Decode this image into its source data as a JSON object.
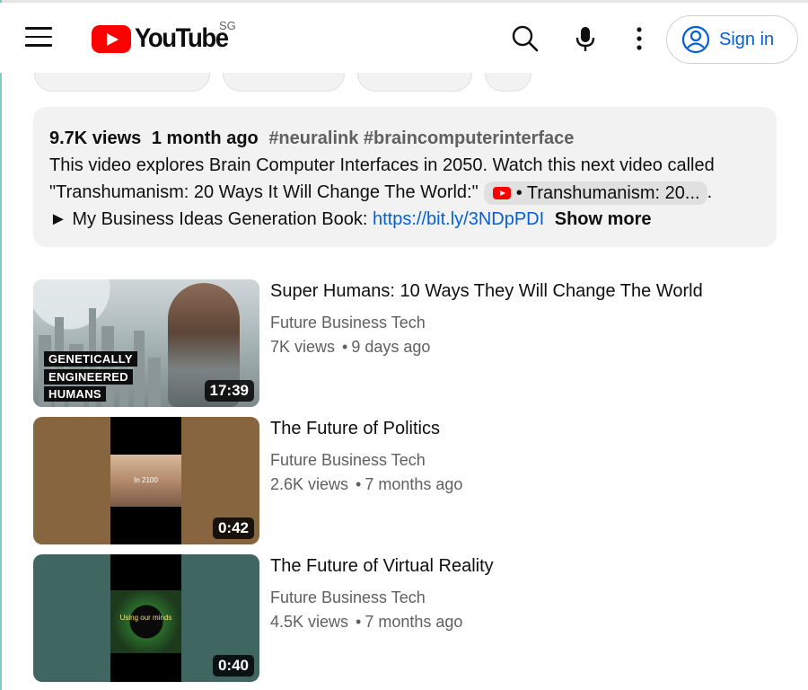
{
  "header": {
    "logo_text": "YouTube",
    "country": "SG",
    "signin_label": "Sign in",
    "icons": [
      "menu-icon",
      "search-icon",
      "microphone-icon",
      "more-vert-icon",
      "account-circle-icon"
    ]
  },
  "description": {
    "views": "9.7K views",
    "age": "1 month ago",
    "hashtags": "#neuralink #braincomputerinterface",
    "line1": "This video explores Brain Computer Interfaces in 2050. Watch this next video called",
    "line2_prefix": "\"Transhumanism: 20 Ways It Will Change The World:\"",
    "linked_video": "• Transhumanism: 20...",
    "line2_suffix": ".",
    "line3_prefix": "► My Business Ideas Generation Book:",
    "line3_link": "https://bit.ly/3NDpPDI",
    "show_more": "Show more"
  },
  "videos": [
    {
      "title": "Super Humans: 10 Ways They Will Change The World",
      "channel": "Future Business Tech",
      "views": "7K views",
      "age": "9 days ago",
      "duration": "17:39",
      "overlay_lines": [
        "GENETICALLY",
        "ENGINEERED",
        "HUMANS"
      ]
    },
    {
      "title": "The Future of Politics",
      "channel": "Future Business Tech",
      "views": "2.6K views",
      "age": "7 months ago",
      "duration": "0:42",
      "overlay_caption": "In 2100"
    },
    {
      "title": "The Future of Virtual Reality",
      "channel": "Future Business Tech",
      "views": "4.5K views",
      "age": "7 months ago",
      "duration": "0:40",
      "overlay_caption": "Using our minds"
    }
  ],
  "colors": {
    "brand_red": "#ff0000",
    "link_blue": "#065fd4",
    "secondary_text": "#606060",
    "panel_bg": "#f2f2f2"
  }
}
